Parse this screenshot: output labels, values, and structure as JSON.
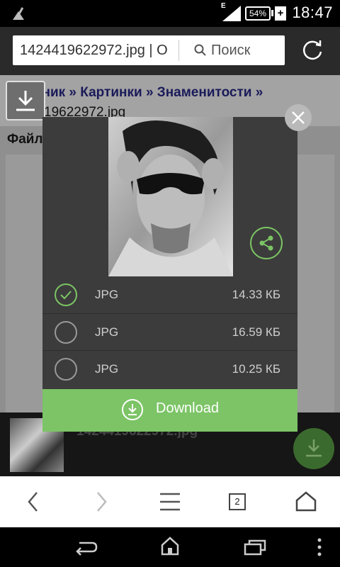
{
  "status_bar": {
    "signal_type": "E",
    "battery": "54%",
    "time": "18:47"
  },
  "url_bar": {
    "url_text": "1424419622972.jpg | O",
    "search_label": "Поиск"
  },
  "page": {
    "breadcrumb_links": "нник » Картинки » Знаменитости »",
    "file_name_partial": "19622972.jpg",
    "section_label": "Файл",
    "bottom_file_name": "1424419622972.jpg"
  },
  "modal": {
    "options": [
      {
        "format": "JPG",
        "size": "14.33 КБ",
        "selected": true
      },
      {
        "format": "JPG",
        "size": "16.59 КБ",
        "selected": false
      },
      {
        "format": "JPG",
        "size": "10.25 КБ",
        "selected": false
      }
    ],
    "download_label": "Download",
    "accent_color": "#7cc466"
  },
  "browser_toolbar": {
    "tab_count": "2"
  },
  "icons": [
    "back-icon",
    "forward-icon",
    "menu-icon",
    "tabs-icon",
    "home-icon",
    "refresh-icon",
    "search-icon",
    "download-icon",
    "share-icon",
    "close-icon",
    "check-icon",
    "nav-back-icon",
    "nav-home-icon",
    "nav-recents-icon",
    "overflow-icon"
  ]
}
